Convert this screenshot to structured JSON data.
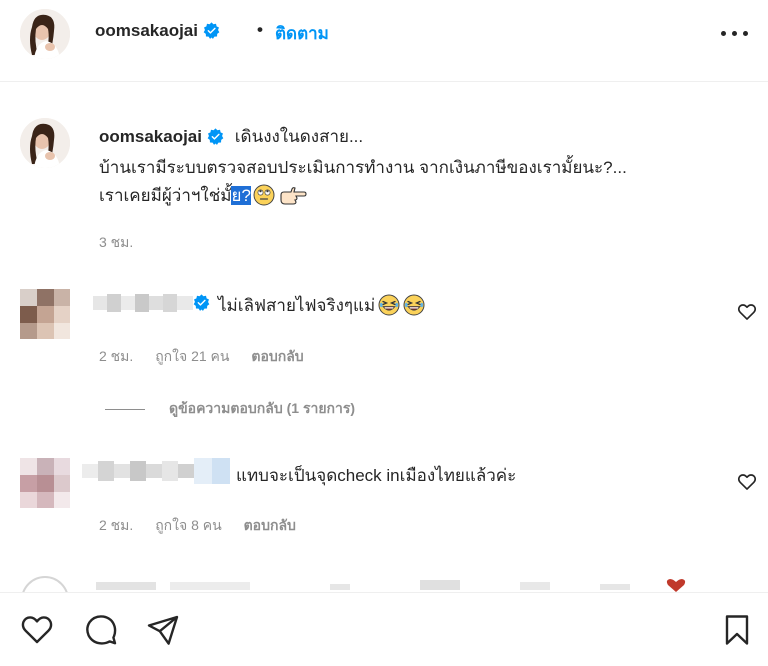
{
  "post_header": {
    "username": "oomsakaojai",
    "separator": "•",
    "follow_label": "ติดตาม"
  },
  "caption": {
    "username": "oomsakaojai",
    "line1": "เดินงงในดงสาย...",
    "line2": "บ้านเรามีระบบตรวจสอบประเมินการทำงาน จากเงินภาษีของเรามั้ยนะ?...",
    "line3_plain": "เราเคยมีผู้ว่าฯใช่มั้",
    "line3_selected": "ย?",
    "time": "3 ชม."
  },
  "comments": [
    {
      "text": "ไม่เลิฟสายไฟจริงๆแม่",
      "time": "2 ชม.",
      "likes": "ถูกใจ 21 คน",
      "reply": "ตอบกลับ",
      "verified": true
    },
    {
      "text": "แทบจะเป็นจุดcheck inเมืองไทยแล้วค่ะ",
      "time": "2 ชม.",
      "likes": "ถูกใจ 8 คน",
      "reply": "ตอบกลับ",
      "verified": false
    }
  ],
  "view_replies": "ดูข้อความตอบกลับ (1 รายการ)",
  "icons": {
    "header_more": "more-horizontal-icon",
    "verified": "verified-badge-icon",
    "comment_like": "heart-outline-icon",
    "like": "heart-outline-icon",
    "comment": "comment-bubble-icon",
    "share": "paper-plane-icon",
    "save": "bookmark-icon"
  },
  "colors": {
    "accent": "#0095f6",
    "text": "#262626",
    "secondary": "#8e8e8e",
    "selection": "#1f6fd6"
  }
}
